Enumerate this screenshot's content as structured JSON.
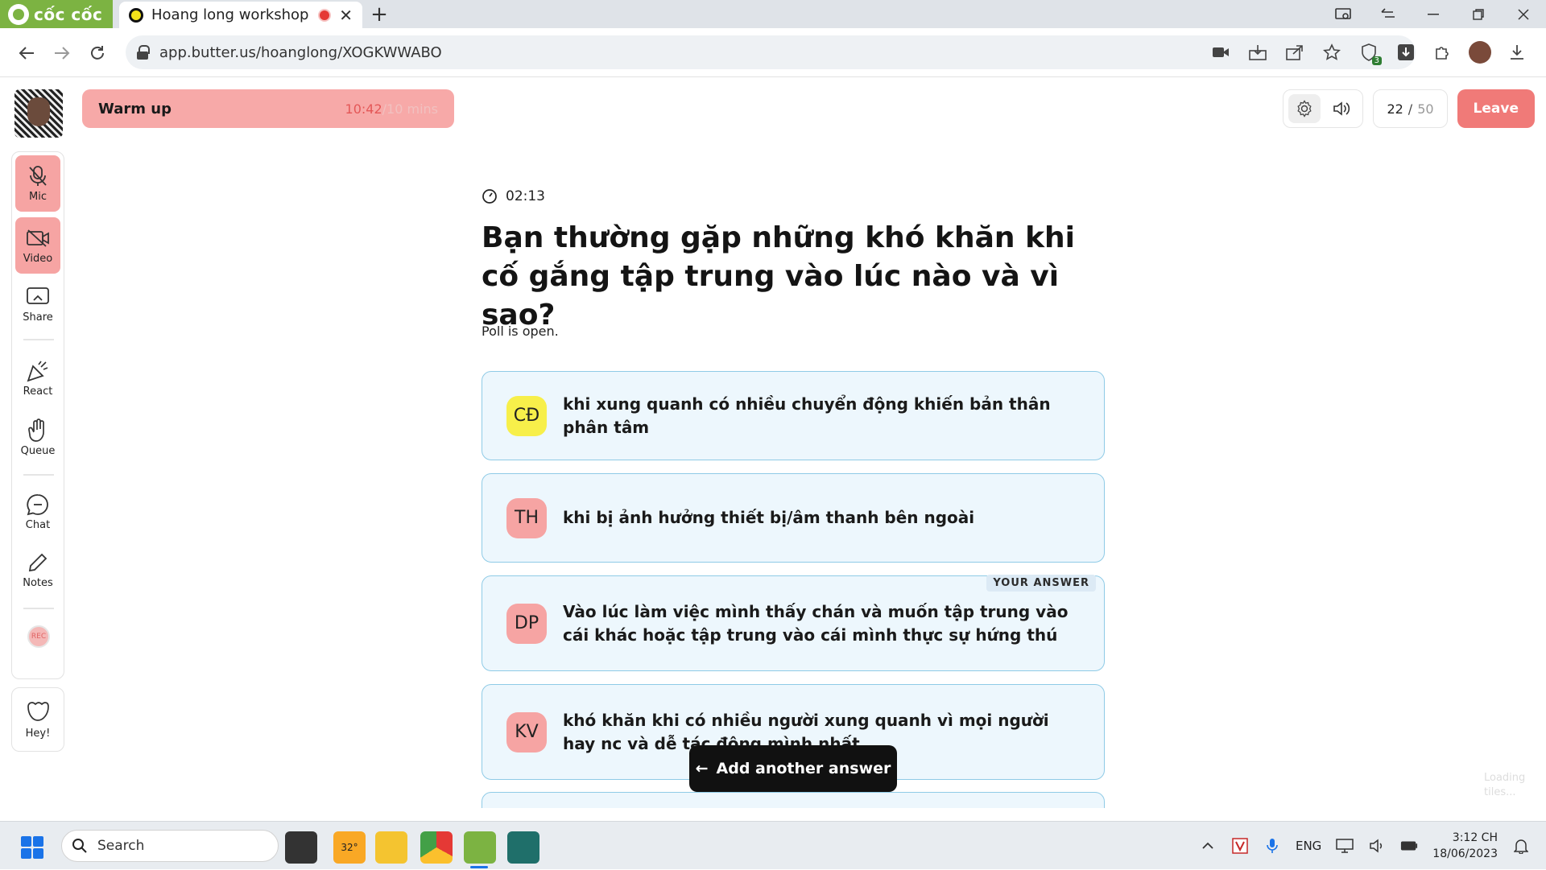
{
  "browser": {
    "brand": "cốc cốc",
    "tab_title": "Hoang long workshop",
    "tab_close": "✕",
    "new_tab": "+",
    "url": "app.butter.us/hoanglong/XOGKWWABO",
    "extension_badge": "3"
  },
  "session": {
    "agenda_title": "Warm up",
    "timer_elapsed": "10:42",
    "timer_total": "/10 mins",
    "participants_current": "22",
    "participants_sep": "/",
    "participants_total": "50",
    "leave_label": "Leave"
  },
  "toolbar": {
    "mic": "Mic",
    "video": "Video",
    "share": "Share",
    "react": "React",
    "queue": "Queue",
    "chat": "Chat",
    "notes": "Notes",
    "rec": "REC",
    "hey": "Hey!"
  },
  "poll": {
    "countdown": "02:13",
    "question": "Bạn thường gặp những khó khăn khi cố gắng tập trung vào lúc nào và vì sao?",
    "status": "Poll is open.",
    "your_answer_label": "YOUR ANSWER",
    "answers": [
      {
        "initials": "CĐ",
        "color": "#f7ef4a",
        "text": "khi xung quanh có nhiều chuyển động khiến bản thân phân tâm"
      },
      {
        "initials": "TH",
        "color": "#f6a4a3",
        "text": "khi bị ảnh hưởng thiết bị/âm thanh bên ngoài"
      },
      {
        "initials": "DP",
        "color": "#f6a4a3",
        "text": "Vào lúc làm việc mình thấy chán và muốn tập trung vào cái khác hoặc tập trung vào cái mình thực sự hứng thú"
      },
      {
        "initials": "KV",
        "color": "#f6a4a3",
        "text": "khó khăn khi có nhiều người xung quanh vì mọi người hay nc và dễ tác động mình nhất"
      }
    ],
    "add_answer_label": "Add another answer",
    "add_answer_arrow": "←",
    "loading_tiles": "Loading tiles..."
  },
  "taskbar": {
    "search_label": "Search",
    "weather": "32°",
    "language": "ENG",
    "time": "3:12 CH",
    "date": "18/06/2023"
  },
  "colors": {
    "accent_pink": "#f6a4a3",
    "leave_red": "#f07a78",
    "answer_bg": "#edf7fd",
    "answer_border": "#8fcbe6",
    "browser_green": "#7cb342"
  }
}
